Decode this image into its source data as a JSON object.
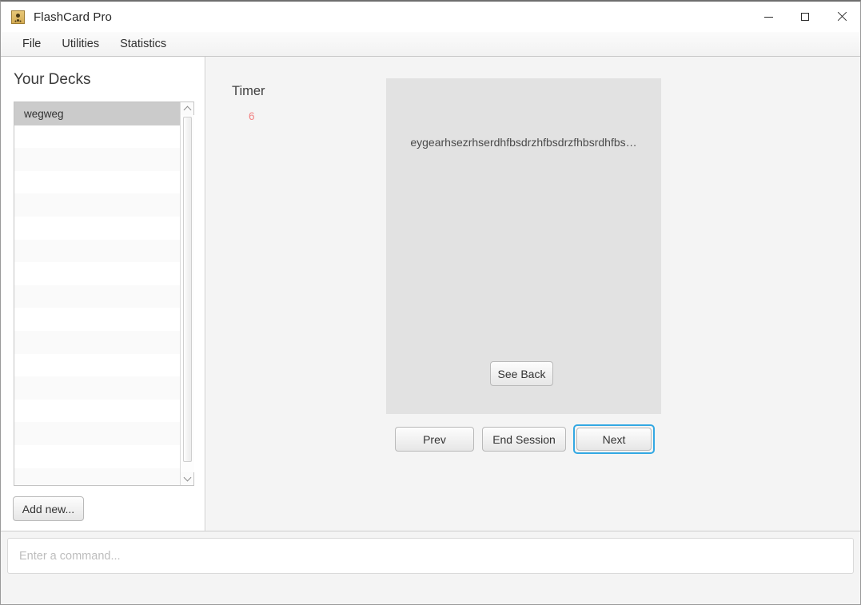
{
  "window": {
    "title": "FlashCard Pro",
    "icon": "app-user-icon",
    "controls": {
      "minimize": "minimize-icon",
      "maximize": "maximize-icon",
      "close": "close-icon"
    }
  },
  "menubar": {
    "items": [
      {
        "label": "File"
      },
      {
        "label": "Utilities"
      },
      {
        "label": "Statistics"
      }
    ]
  },
  "sidebar": {
    "title": "Your Decks",
    "decks": [
      {
        "label": "wegweg",
        "selected": true
      },
      {
        "label": "",
        "selected": false
      },
      {
        "label": "",
        "selected": false
      },
      {
        "label": "",
        "selected": false
      },
      {
        "label": "",
        "selected": false
      },
      {
        "label": "",
        "selected": false
      },
      {
        "label": "",
        "selected": false
      },
      {
        "label": "",
        "selected": false
      },
      {
        "label": "",
        "selected": false
      },
      {
        "label": "",
        "selected": false
      },
      {
        "label": "",
        "selected": false
      },
      {
        "label": "",
        "selected": false
      },
      {
        "label": "",
        "selected": false
      },
      {
        "label": "",
        "selected": false
      },
      {
        "label": "",
        "selected": false
      },
      {
        "label": "",
        "selected": false
      },
      {
        "label": "",
        "selected": false
      }
    ],
    "scrollbar": {
      "up_arrow": "chevron-up-icon",
      "down_arrow": "chevron-down-icon"
    },
    "add_new_label": "Add new..."
  },
  "main": {
    "timer": {
      "label": "Timer",
      "value": "6",
      "value_color": "#f28282"
    },
    "card": {
      "front_text": "eygearhsezrhserdhfbsdrzhfbsdrzfhbsrdhfbs…",
      "see_back_label": "See Back",
      "background": "#e2e2e2"
    },
    "nav": {
      "prev_label": "Prev",
      "end_session_label": "End Session",
      "next_label": "Next",
      "focused_button": "Next",
      "focus_ring_color": "#33a8e3"
    }
  },
  "command_bar": {
    "placeholder": "Enter a command...",
    "value": ""
  }
}
